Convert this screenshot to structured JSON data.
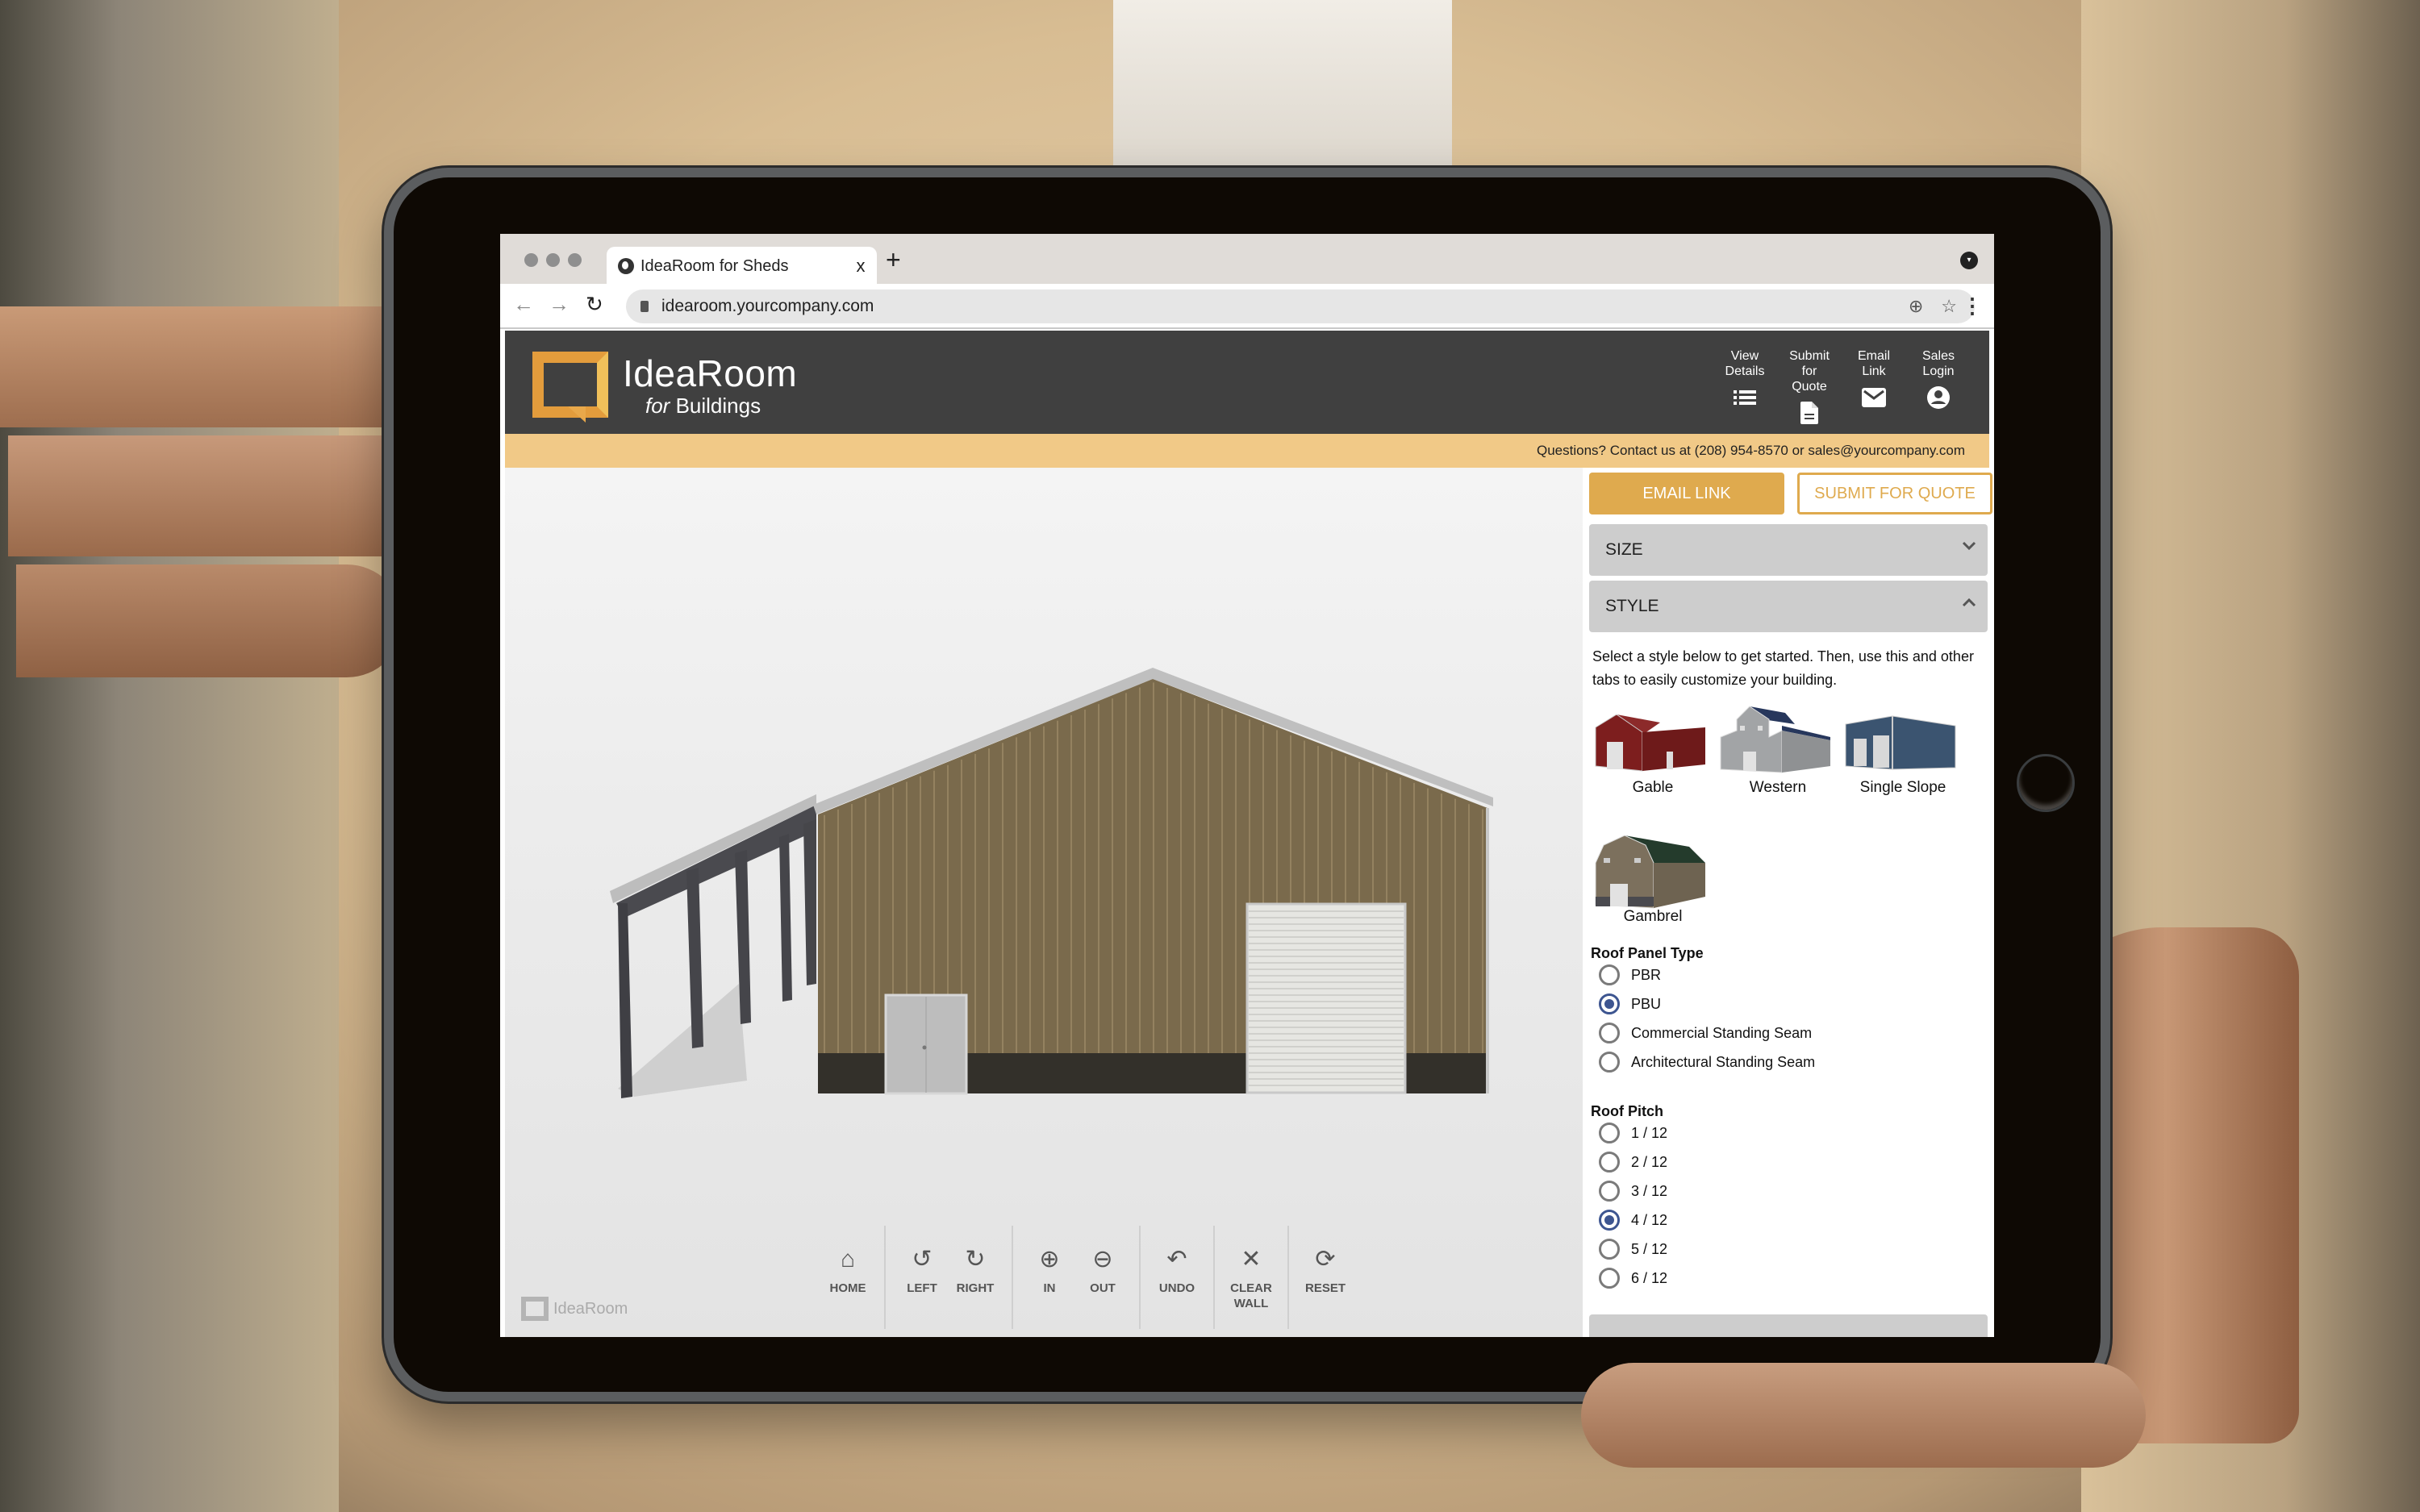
{
  "browser": {
    "tab_title": "IdeaRoom for Sheds",
    "tab_close": "x",
    "new_tab": "+",
    "url": "idearoom.yourcompany.com",
    "back": "←",
    "forward": "→",
    "reload": "↻",
    "zoom_icon": "⊕",
    "bookmark_icon": "☆",
    "menu_icon": "⋮",
    "profile_icon": "▾"
  },
  "header": {
    "brand_main": "IdeaRoom",
    "brand_for": "for",
    "brand_sub": "Buildings",
    "actions": [
      {
        "line1": "View",
        "line2": "Details",
        "icon": "list-icon"
      },
      {
        "line1": "Submit",
        "line2": "for Quote",
        "icon": "document-icon"
      },
      {
        "line1": "Email",
        "line2": "Link",
        "icon": "mail-icon"
      },
      {
        "line1": "Sales",
        "line2": "Login",
        "icon": "account-icon"
      }
    ]
  },
  "contact": {
    "text": "Questions? Contact us at (208) 954-8570 or sales@yourcompany.com"
  },
  "colors": {
    "header_bg": "#404040",
    "accent": "#dfaa4e",
    "contact_bar": "#f1c987",
    "radio_selected": "#3d5590",
    "wall": "#7a6a4c",
    "wainscot": "#33302a",
    "trim": "#b7b7b7",
    "lean_to_frame": "#46464a"
  },
  "viewer": {
    "toolbar": [
      {
        "label": "HOME",
        "icon": "home-icon",
        "glyph": "⌂"
      },
      {
        "label": "LEFT",
        "icon": "rotate-left-icon",
        "glyph": "↺"
      },
      {
        "label": "RIGHT",
        "icon": "rotate-right-icon",
        "glyph": "↻"
      },
      {
        "label": "IN",
        "icon": "zoom-in-icon",
        "glyph": "⊕"
      },
      {
        "label": "OUT",
        "icon": "zoom-out-icon",
        "glyph": "⊖"
      },
      {
        "label": "UNDO",
        "icon": "undo-icon",
        "glyph": "↶"
      },
      {
        "label": "CLEAR",
        "label2": "WALL",
        "icon": "clear-wall-icon",
        "glyph": "✕"
      },
      {
        "label": "RESET",
        "icon": "reset-icon",
        "glyph": "⟳"
      }
    ],
    "watermark": "IdeaRoom"
  },
  "panel": {
    "email_link": "EMAIL LINK",
    "submit_quote": "SUBMIT FOR QUOTE",
    "sections": [
      {
        "label": "SIZE",
        "state": "collapsed",
        "chevron": "⌄"
      },
      {
        "label": "STYLE",
        "state": "expanded",
        "chevron": "⌃"
      }
    ],
    "intro": "Select a style below to get started. Then, use this and other tabs to easily customize your building.",
    "styles": [
      {
        "label": "Gable",
        "wall": "#7d1e1e",
        "roof": "#7d1e1e"
      },
      {
        "label": "Western",
        "wall": "#9a9c9e",
        "roof": "#27375c"
      },
      {
        "label": "Single Slope",
        "wall": "#3b5470",
        "roof": "#3b5470"
      },
      {
        "label": "Gambrel",
        "wall": "#7c705d",
        "roof": "#243b2c"
      }
    ],
    "roof_panel": {
      "title": "Roof Panel Type",
      "options": [
        "PBR",
        "PBU",
        "Commercial Standing Seam",
        "Architectural Standing Seam"
      ],
      "selected": "PBU"
    },
    "roof_pitch": {
      "title": "Roof Pitch",
      "options": [
        "1 / 12",
        "2 / 12",
        "3 / 12",
        "4 / 12",
        "5 / 12",
        "6 / 12"
      ],
      "selected": "4 / 12"
    }
  }
}
